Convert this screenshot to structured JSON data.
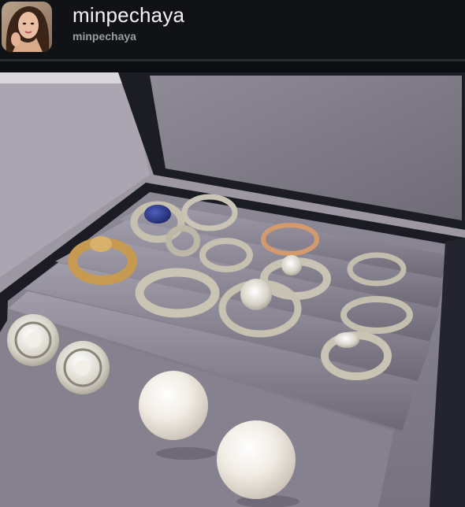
{
  "post": {
    "display_name": "minpechaya",
    "handle": "minpechaya"
  },
  "photo": {
    "description_icon": "jewelry-box-photo"
  }
}
